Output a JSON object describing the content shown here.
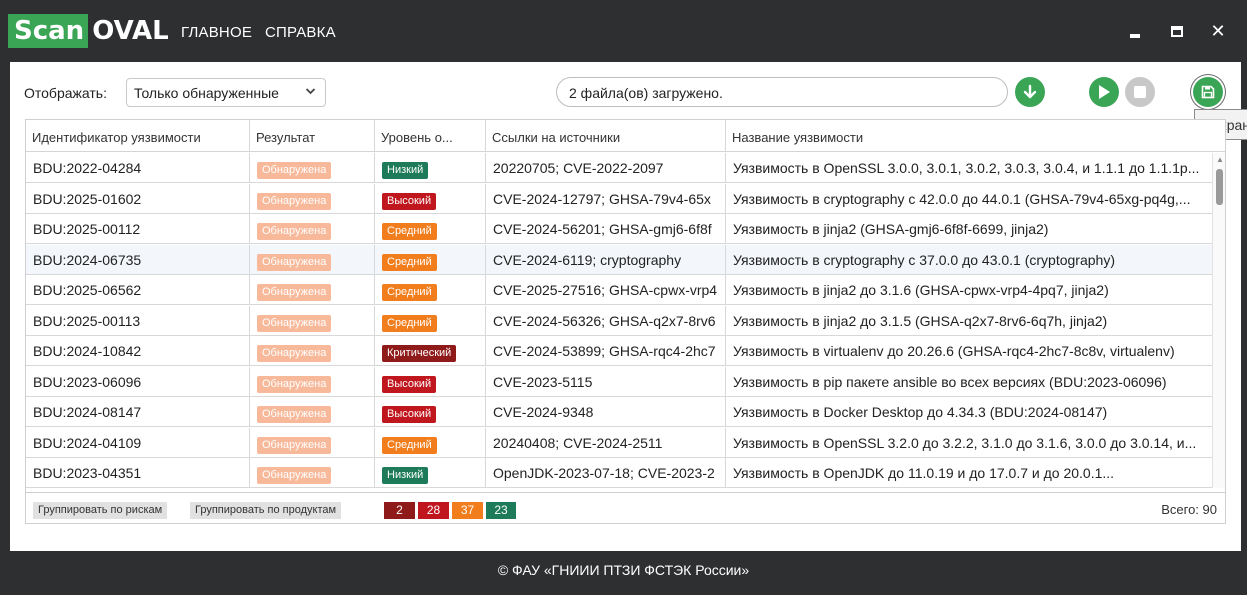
{
  "app": {
    "logo_part1": "Scan",
    "logo_part2": "OVAL",
    "nav": [
      "ГЛАВНОЕ",
      "СПРАВКА"
    ],
    "accent_color": "#3aa655"
  },
  "toolbar": {
    "show_label": "Отображать:",
    "filter_value": "Только обнаруженные",
    "status_text": "2 файла(ов) загружено.",
    "tooltip": "Сохранить"
  },
  "table": {
    "columns": [
      "Идентификатор уязвимости",
      "Результат",
      "Уровень о...",
      "Ссылки на источники",
      "Название уязвимости"
    ],
    "rows": [
      {
        "id": "BDU:2022-04284",
        "result": "Обнаружена",
        "level": "Низкий",
        "level_class": "low",
        "refs": "20220705; CVE-2022-2097",
        "name": "Уязвимость в OpenSSL 3.0.0, 3.0.1, 3.0.2, 3.0.3, 3.0.4, и 1.1.1 до 1.1.1p..."
      },
      {
        "id": "BDU:2025-01602",
        "result": "Обнаружена",
        "level": "Высокий",
        "level_class": "high",
        "refs": "CVE-2024-12797; GHSA-79v4-65x",
        "name": "Уязвимость в cryptography с 42.0.0 до 44.0.1 (GHSA-79v4-65xg-pq4g,..."
      },
      {
        "id": "BDU:2025-00112",
        "result": "Обнаружена",
        "level": "Средний",
        "level_class": "mid",
        "refs": "CVE-2024-56201; GHSA-gmj6-6f8f",
        "name": "Уязвимость в jinja2 (GHSA-gmj6-6f8f-6699, jinja2)"
      },
      {
        "id": "BDU:2024-06735",
        "result": "Обнаружена",
        "level": "Средний",
        "level_class": "mid",
        "refs": "CVE-2024-6119; cryptography",
        "name": "Уязвимость в cryptography с 37.0.0 до 43.0.1 (cryptography)"
      },
      {
        "id": "BDU:2025-06562",
        "result": "Обнаружена",
        "level": "Средний",
        "level_class": "mid",
        "refs": "CVE-2025-27516; GHSA-cpwx-vrp4",
        "name": "Уязвимость в jinja2 до 3.1.6 (GHSA-cpwx-vrp4-4pq7, jinja2)"
      },
      {
        "id": "BDU:2025-00113",
        "result": "Обнаружена",
        "level": "Средний",
        "level_class": "mid",
        "refs": "CVE-2024-56326; GHSA-q2x7-8rv6",
        "name": "Уязвимость в jinja2 до 3.1.5 (GHSA-q2x7-8rv6-6q7h, jinja2)"
      },
      {
        "id": "BDU:2024-10842",
        "result": "Обнаружена",
        "level": "Критический",
        "level_class": "crit",
        "refs": "CVE-2024-53899; GHSA-rqc4-2hc7",
        "name": "Уязвимость в virtualenv до 20.26.6 (GHSA-rqc4-2hc7-8c8v, virtualenv)"
      },
      {
        "id": "BDU:2023-06096",
        "result": "Обнаружена",
        "level": "Высокий",
        "level_class": "high",
        "refs": "CVE-2023-5115",
        "name": "Уязвимость в pip пакете ansible во всех версиях (BDU:2023-06096)"
      },
      {
        "id": "BDU:2024-08147",
        "result": "Обнаружена",
        "level": "Высокий",
        "level_class": "high",
        "refs": "CVE-2024-9348",
        "name": "Уязвимость в Docker Desktop до 4.34.3 (BDU:2024-08147)"
      },
      {
        "id": "BDU:2024-04109",
        "result": "Обнаружена",
        "level": "Средний",
        "level_class": "mid",
        "refs": "20240408; CVE-2024-2511",
        "name": "Уязвимость в OpenSSL 3.2.0 до 3.2.2, 3.1.0 до 3.1.6, 3.0.0 до 3.0.14, и..."
      },
      {
        "id": "BDU:2023-04351",
        "result": "Обнаружена",
        "level": "Низкий",
        "level_class": "low",
        "refs": "OpenJDK-2023-07-18; CVE-2023-2",
        "name": "Уязвимость в OpenJDK до 11.0.19 и до 17.0.7 и до 20.0.1..."
      }
    ],
    "group_by_risk": "Группировать по рискам",
    "group_by_product": "Группировать по продуктам",
    "counts": {
      "critical": "2",
      "high": "28",
      "medium": "37",
      "low": "23"
    },
    "total": "Всего: 90"
  },
  "colors": {
    "found": "#f7b99a",
    "low": "#1e7b5a",
    "medium": "#f27d1c",
    "high": "#c0161e",
    "critical": "#8f1a1a"
  },
  "footer": {
    "copyright": "© ФАУ «ГНИИИ ПТЗИ ФСТЭК России»"
  }
}
